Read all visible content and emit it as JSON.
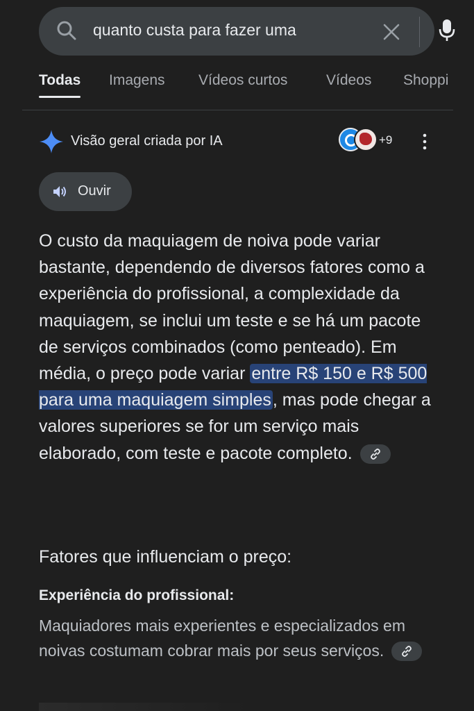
{
  "search": {
    "query": "quanto custa para fazer uma"
  },
  "tabs": [
    {
      "label": "Todas",
      "active": true
    },
    {
      "label": "Imagens"
    },
    {
      "label": "Vídeos curtos"
    },
    {
      "label": "Vídeos"
    },
    {
      "label": "Shoppi"
    }
  ],
  "ai_overview": {
    "title": "Visão geral criada por IA",
    "sources_more": "+9",
    "listen_label": "Ouvir",
    "paragraph": {
      "before": "O custo da maquiagem de noiva pode variar bastante, dependendo de diversos fatores como a experiência do profissional, a complexidade da maquiagem, se inclui um teste e se há um pacote de serviços combinados (como penteado). Em média, o preço pode variar ",
      "highlight": "entre R$ 150 e R$ 500 para uma maquiagem simples",
      "after": ", mas pode chegar a valores superiores se for um serviço mais elaborado, com teste e pacote completo."
    },
    "section_heading": "Fatores que influenciam o preço:",
    "factor_title": "Experiência do profissional:",
    "factor_text": "Maquiadores mais experientes e especializados em noivas costumam cobrar mais por seus serviços."
  },
  "colors": {
    "background": "#1f1f1f",
    "highlight": "#284377",
    "sparkle": "#4d8df6"
  }
}
